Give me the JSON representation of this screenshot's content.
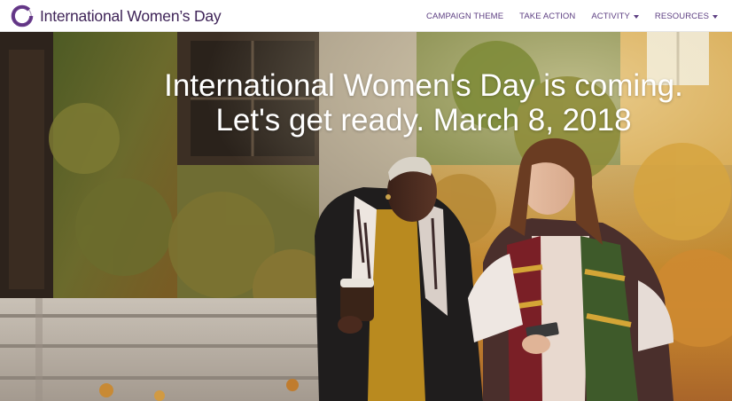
{
  "brand": {
    "name": "International Women’s Day",
    "logo_icon": "iwd-ring-logo-icon",
    "color": "#3f2458"
  },
  "nav": {
    "color": "#5d3f82",
    "items": [
      {
        "label": "CAMPAIGN THEME",
        "has_dropdown": false
      },
      {
        "label": "TAKE ACTION",
        "has_dropdown": false
      },
      {
        "label": "ACTIVITY",
        "has_dropdown": true,
        "icon": "caret-down-icon"
      },
      {
        "label": "RESOURCES",
        "has_dropdown": true,
        "icon": "caret-down-icon"
      }
    ]
  },
  "hero": {
    "headline_line1": "International Women's Day is coming.",
    "headline_line2": "Let's get ready. March 8, 2018",
    "text_color": "#ffffff"
  }
}
